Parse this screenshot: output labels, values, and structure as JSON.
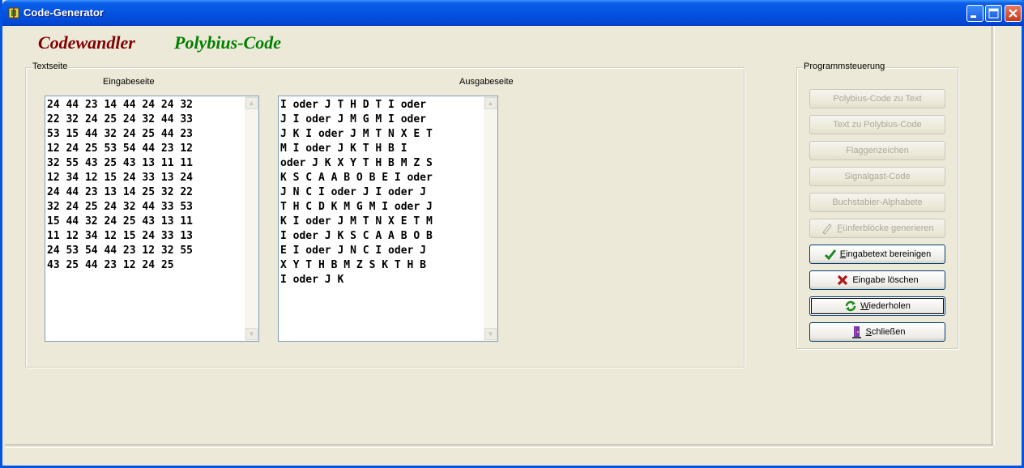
{
  "window": {
    "title": "Code-Generator"
  },
  "headings": {
    "app_name": "Codewandler",
    "code_name": "Polybius-Code"
  },
  "textseite": {
    "group_label": "Textseite",
    "input_label": "Eingabeseite",
    "output_label": "Ausgabeseite",
    "input_lines": [
      "24 44 23 14 44 24 24 32",
      "22 32 24 25 24 32 44 33",
      "53 15 44 32 24 25 44 23",
      "12 24 25 53 54 44 23 12",
      "32 55 43 25 43 13 11 11",
      "12 34 12 15 24 33 13 24",
      "24 44 23 13 14 25 32 22",
      "32 24 25 24 32 44 33 53",
      "15 44 32 24 25 43 13 11",
      "11 12 34 12 15 24 33 13",
      "24 53 54 44 23 12 32 55",
      "43 25 44 23 12 24 25"
    ],
    "output_lines": [
      "I oder J T H D T I oder",
      "J I oder J M G M I oder",
      "J K I oder J M T N X E T",
      "M I oder J K T H B I",
      "oder J K X Y T H B M Z S",
      "K S C A A B O B E I oder",
      "J N C I oder J I oder J",
      "T H C D K M G M I oder J",
      "K I oder J M T N X E T M",
      "I oder J K S C A A B O B",
      "E I oder J N C I oder J",
      "X Y T H B M Z S K T H B",
      "I oder J K"
    ]
  },
  "programmsteuerung": {
    "group_label": "Programmsteuerung",
    "buttons": {
      "polybius_to_text": "Polybius-Code zu Text",
      "text_to_polybius": "Text zu Polybius-Code",
      "flaggenzeichen": "Flaggenzeichen",
      "signalgast": "Signalgast-Code",
      "buchstabier": "Buchstabier-Alphabete",
      "fuenferbloecke": "Fünferblöcke generieren",
      "bereinigen": "Eingabetext bereinigen",
      "loeschen": "Eingabe löschen",
      "wiederholen": "Wiederholen",
      "schliessen": "Schließen"
    }
  },
  "colors": {
    "heading_app": "#800000",
    "heading_code": "#008000",
    "window_face": "#ece9d8",
    "titlebar": "#0553e1"
  }
}
